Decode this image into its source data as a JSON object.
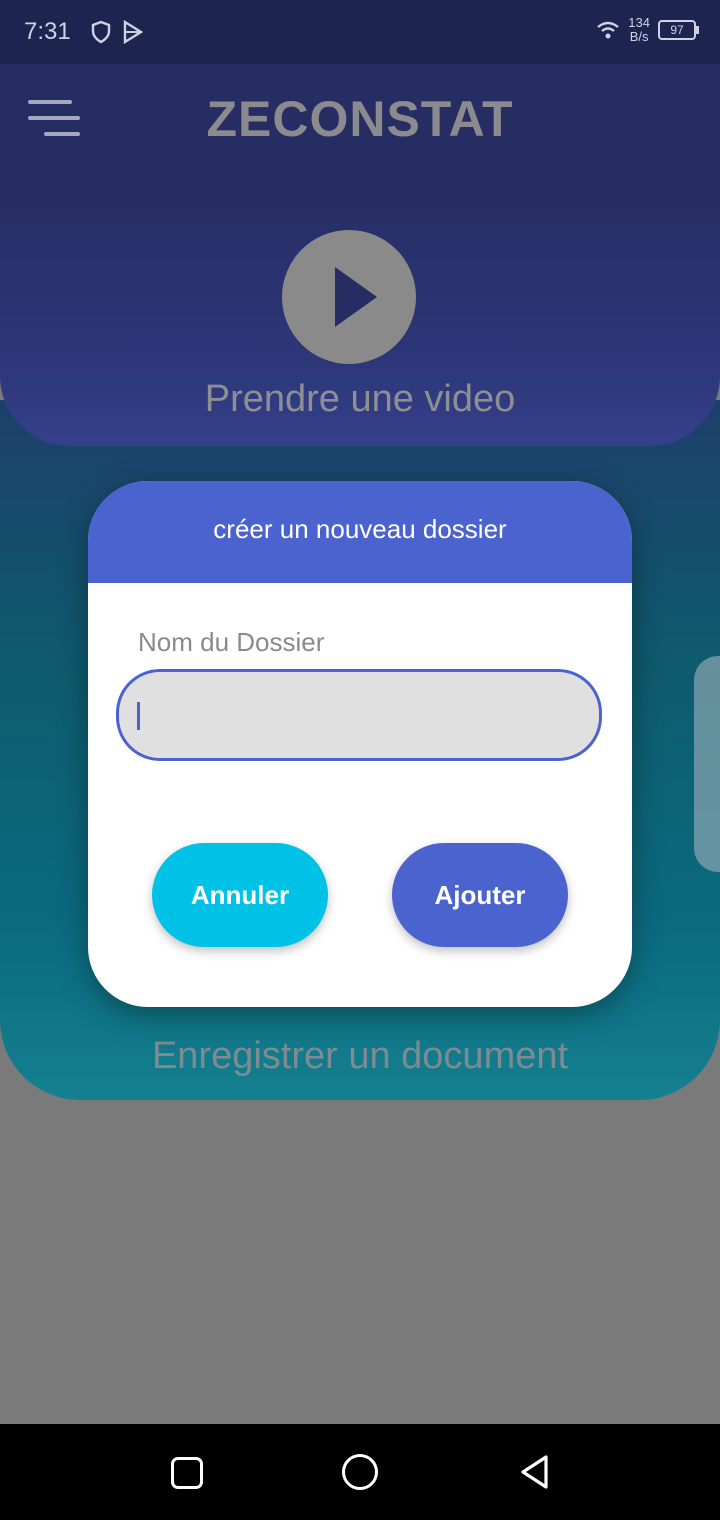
{
  "status_bar": {
    "time": "7:31",
    "net_speed_value": "134",
    "net_speed_unit": "B/s",
    "battery": "97"
  },
  "app_bar": {
    "title": "ZECONSTAT"
  },
  "main": {
    "video_label": "Prendre une video",
    "document_label": "Enregistrer un document"
  },
  "dialog": {
    "title": "créer un nouveau dossier",
    "field_label": "Nom du Dossier",
    "field_value": "",
    "cancel_label": "Annuler",
    "add_label": "Ajouter"
  },
  "colors": {
    "primary": "#4a63cf",
    "accent": "#00c2e6",
    "appbar": "#262d63"
  },
  "icons": [
    "menu-icon",
    "play-icon",
    "shield-icon",
    "play-store-icon",
    "wifi-icon",
    "battery-icon",
    "recents-icon",
    "home-icon",
    "back-icon"
  ]
}
